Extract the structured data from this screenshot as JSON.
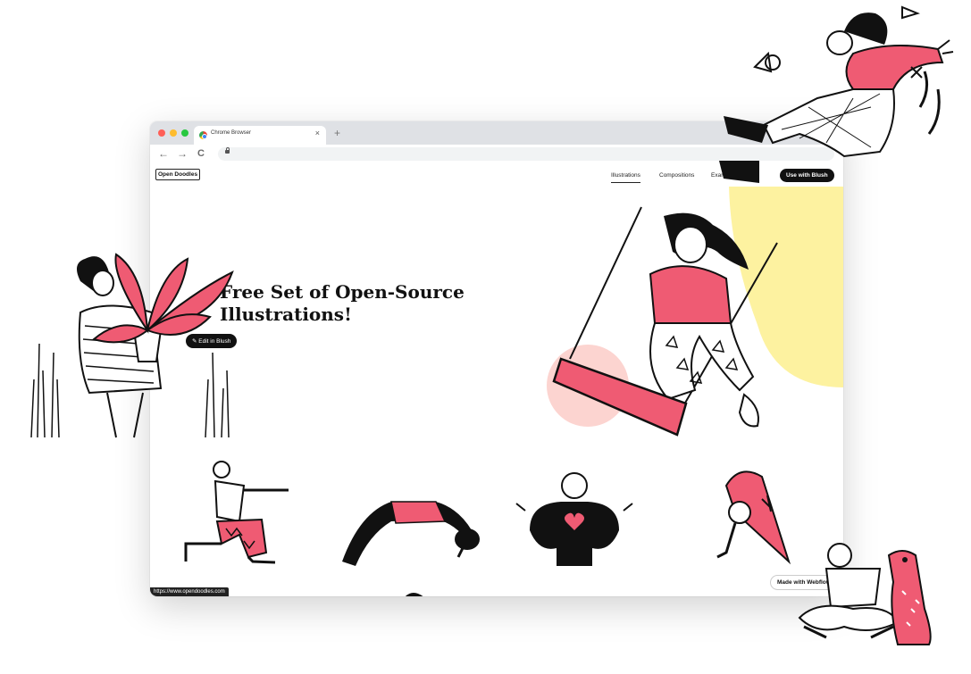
{
  "browser": {
    "tab_title": "Chrome Browser",
    "new_tab": "+",
    "close": "×",
    "back": "←",
    "forward": "→",
    "reload": "C",
    "traffic_lights": {
      "close": "#ff5f57",
      "minimize": "#febc2e",
      "maximize": "#28c840"
    }
  },
  "site": {
    "logo": "Open Doodles",
    "nav": {
      "illustrations": "Illustrations",
      "compositions": "Compositions",
      "examples": "Examples",
      "use_with_blush": "Use with Blush"
    },
    "hero_title": "Free Set of Open-Source Illustrations!",
    "edit_in_blush": "Edit in Blush",
    "status_url": "https://www.opendoodles.com",
    "made_with_webflow": "Made with Webflow"
  },
  "colors": {
    "accent": "#ef5b73",
    "yellow": "#fdf2a0",
    "peach": "#fcd4d0",
    "ink": "#111111"
  }
}
